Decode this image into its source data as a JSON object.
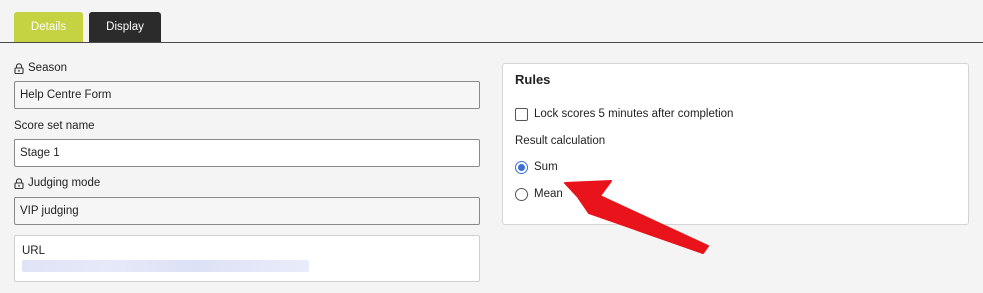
{
  "tabs": [
    {
      "label": "Details"
    },
    {
      "label": "Display"
    }
  ],
  "form": {
    "season": {
      "label": "Season",
      "value": "Help Centre Form"
    },
    "score_set_name": {
      "label": "Score set name",
      "value": "Stage 1"
    },
    "judging_mode": {
      "label": "Judging mode",
      "value": "VIP judging"
    },
    "url": {
      "label": "URL"
    }
  },
  "rules": {
    "title": "Rules",
    "lock_scores": {
      "label": "Lock scores 5 minutes after completion",
      "checked": false
    },
    "result_calculation": {
      "label": "Result calculation",
      "options": [
        {
          "label": "Sum",
          "selected": true
        },
        {
          "label": "Mean",
          "selected": false
        }
      ]
    }
  },
  "colors": {
    "tab_active": "#c5d241",
    "tab_inactive": "#2b2b2b",
    "radio_selected": "#3a6fd8",
    "annotation_arrow": "#e8131b"
  },
  "icons": [
    "lock-icon",
    "annotation-arrow"
  ]
}
